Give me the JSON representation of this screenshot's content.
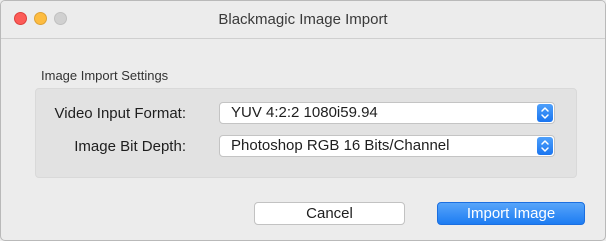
{
  "window": {
    "title": "Blackmagic Image Import"
  },
  "settings": {
    "group_label": "Image Import Settings",
    "video_input_format": {
      "label": "Video Input Format:",
      "value": "YUV 4:2:2 1080i59.94"
    },
    "image_bit_depth": {
      "label": "Image Bit Depth:",
      "value": "Photoshop RGB 16 Bits/Channel"
    }
  },
  "buttons": {
    "cancel": "Cancel",
    "import": "Import Image"
  },
  "colors": {
    "close": "#fc5b57",
    "minimize": "#fdbc40",
    "zoom_inactive": "#d0d0d0",
    "accent": "#1d7cf2"
  },
  "icons": {
    "select_stepper": "up-down-chevron-icon"
  }
}
